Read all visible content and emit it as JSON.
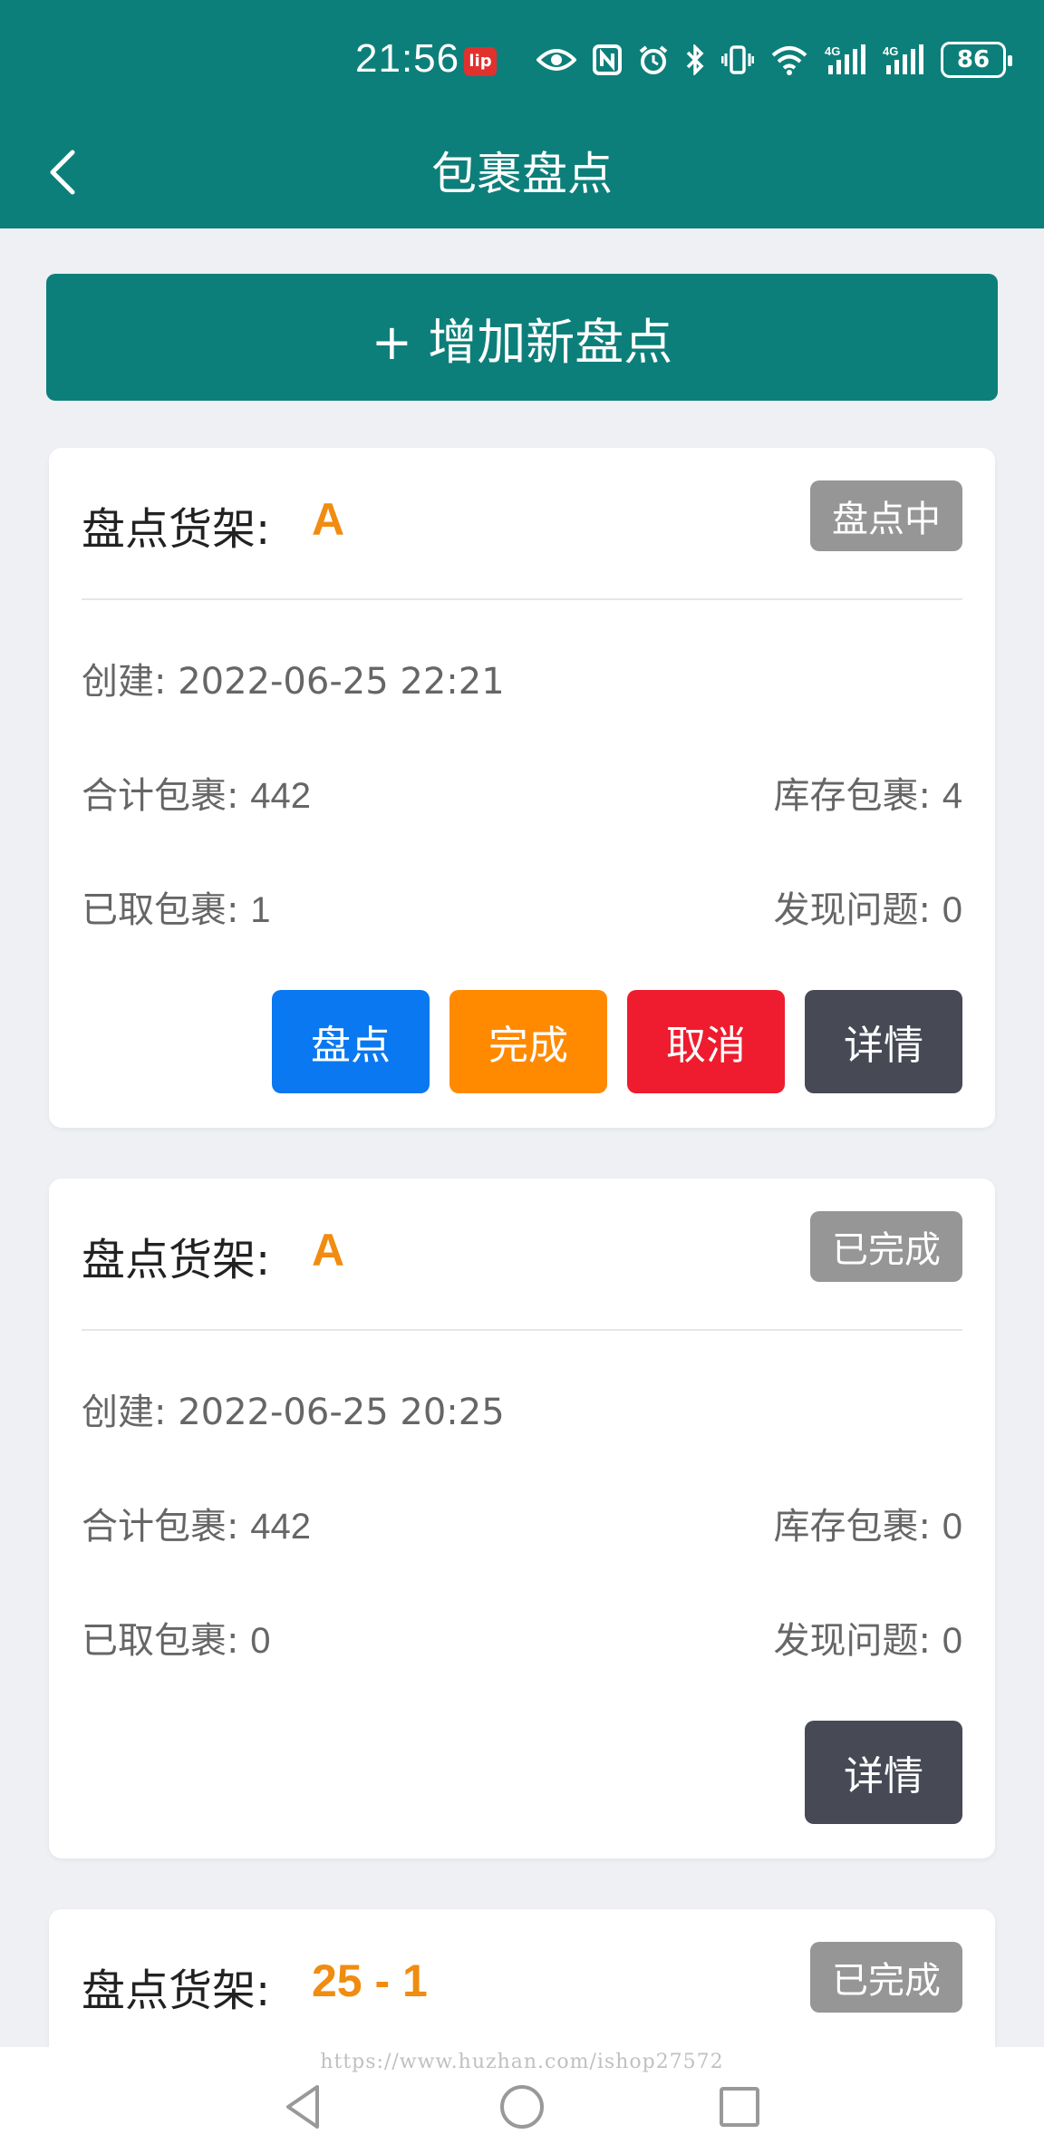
{
  "status_bar": {
    "time": "21:56",
    "app_badge": "lip",
    "battery": "86",
    "icons": [
      "eye-icon",
      "nfc-icon",
      "alarm-icon",
      "bluetooth-icon",
      "vibrate-icon",
      "wifi-icon",
      "signal-4g-icon",
      "signal-4g-icon"
    ],
    "network_label": "4G"
  },
  "header": {
    "title": "包裹盘点"
  },
  "add_button_label": "+ 增加新盘点",
  "cards": [
    {
      "shelf_label": "盘点货架:",
      "shelf_value": "A",
      "status": "盘点中",
      "created": "创建: 2022-06-25 22:21",
      "total_label": "合计包裹:",
      "total_value": "442",
      "stock_label": "库存包裹:",
      "stock_value": "4",
      "taken_label": "已取包裹:",
      "taken_value": "1",
      "issues_label": "发现问题:",
      "issues_value": "0",
      "buttons": [
        "盘点",
        "完成",
        "取消",
        "详情"
      ]
    },
    {
      "shelf_label": "盘点货架:",
      "shelf_value": "A",
      "status": "已完成",
      "created": "创建: 2022-06-25 20:25",
      "total_label": "合计包裹:",
      "total_value": "442",
      "stock_label": "库存包裹:",
      "stock_value": "0",
      "taken_label": "已取包裹:",
      "taken_value": "0",
      "issues_label": "发现问题:",
      "issues_value": "0",
      "buttons": [
        "详情"
      ]
    },
    {
      "shelf_label": "盘点货架:",
      "shelf_value": "25 - 1",
      "status": "已完成"
    }
  ],
  "watermark": "https://www.huzhan.com/ishop27572",
  "colors": {
    "primary": "#0d7f7a",
    "accent": "#f08c10",
    "blue": "#0a78f0",
    "orange": "#ff8a00",
    "red": "#ee1c2e",
    "dark": "#474a55",
    "badge": "#969696"
  }
}
